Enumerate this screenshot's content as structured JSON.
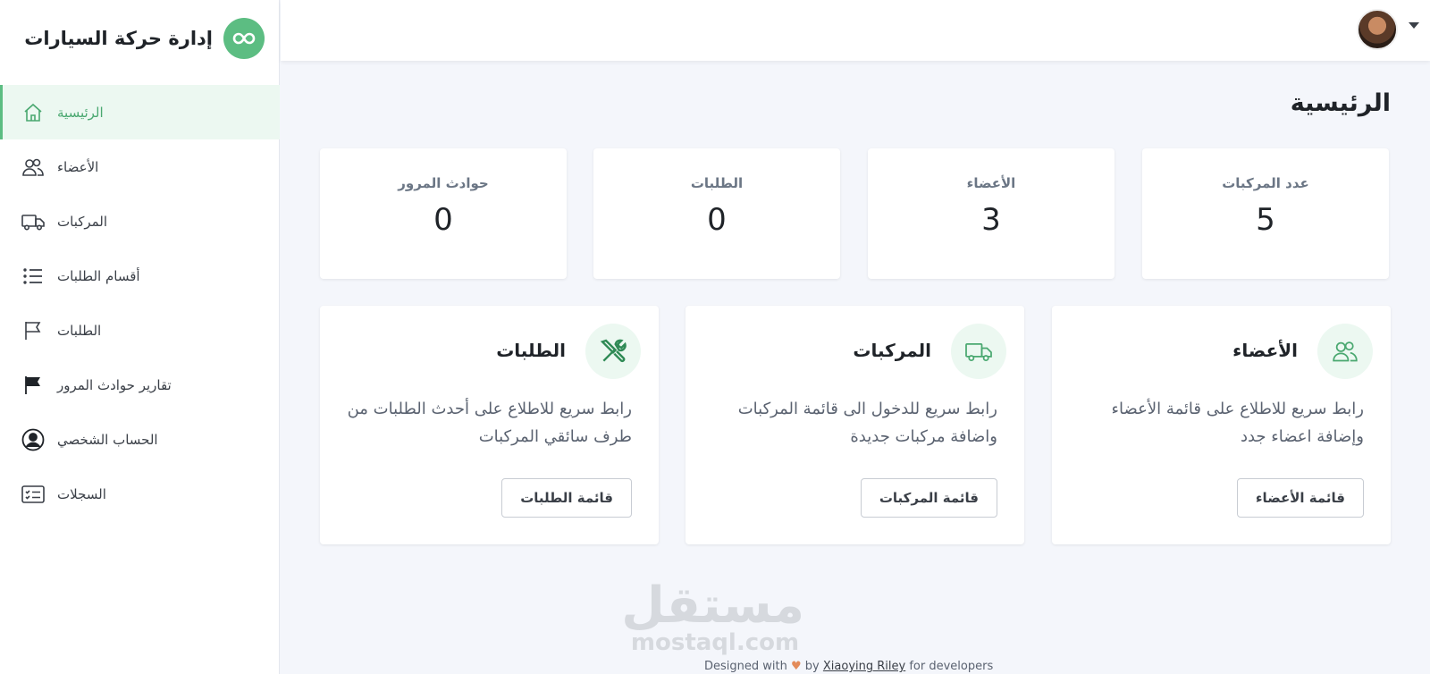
{
  "brand": {
    "title": "إدارة حركة السيارات",
    "logo_icon": "infinity-icon",
    "accent": "#5cbd82"
  },
  "sidebar": {
    "items": [
      {
        "label": "الرئيسية",
        "icon": "home-icon",
        "active": true
      },
      {
        "label": "الأعضاء",
        "icon": "users-icon"
      },
      {
        "label": "المركبات",
        "icon": "truck-icon"
      },
      {
        "label": "أقسام الطلبات",
        "icon": "list-icon"
      },
      {
        "label": "الطلبات",
        "icon": "flag-outline-icon"
      },
      {
        "label": "تقارير حوادث المرور",
        "icon": "flag-filled-icon"
      },
      {
        "label": "الحساب الشخصي",
        "icon": "user-circle-icon"
      },
      {
        "label": "السجلات",
        "icon": "checklist-icon"
      }
    ]
  },
  "main": {
    "title": "الرئيسية",
    "stats": [
      {
        "label": "عدد المركبات",
        "value": "5"
      },
      {
        "label": "الأعضاء",
        "value": "3"
      },
      {
        "label": "الطلبات",
        "value": "0"
      },
      {
        "label": "حوادث المرور",
        "value": "0"
      }
    ],
    "cards": [
      {
        "title": "الأعضاء",
        "icon": "users-icon",
        "desc": "رابط سريع للاطلاع على قائمة الأعضاء وإضافة اعضاء جدد",
        "button": "قائمة الأعضاء"
      },
      {
        "title": "المركبات",
        "icon": "truck-icon",
        "desc": "رابط سريع للدخول الى قائمة المركبات واضافة مركبات جديدة",
        "button": "قائمة المركبات"
      },
      {
        "title": "الطلبات",
        "icon": "tools-icon",
        "desc": "رابط سريع للاطلاع على أحدث الطلبات من طرف سائقي المركبات",
        "button": "قائمة الطلبات"
      }
    ]
  },
  "watermark": {
    "arabic": "مستقل",
    "latin": "mostaql.com"
  },
  "footer": {
    "prefix": "Designed with",
    "by": "by",
    "author": "Xiaoying Riley",
    "suffix": "for developers"
  }
}
